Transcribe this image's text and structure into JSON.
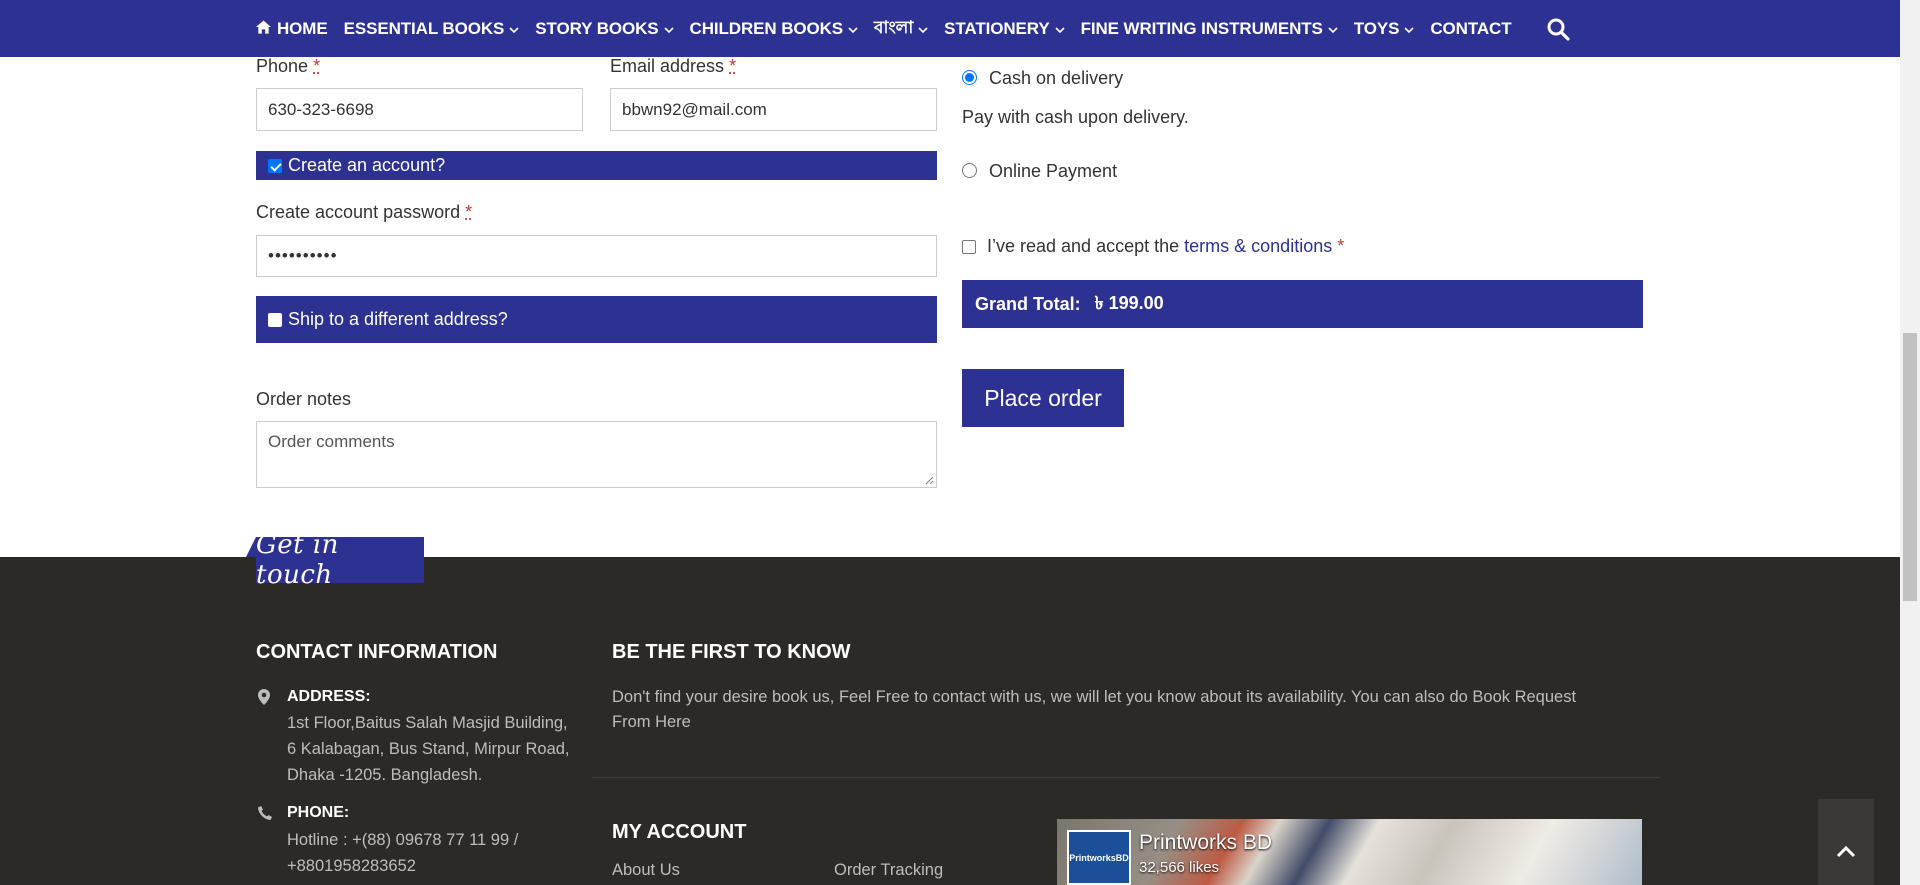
{
  "nav": {
    "items": [
      {
        "label": "HOME",
        "has_home_icon": true,
        "dropdown": false
      },
      {
        "label": "ESSENTIAL BOOKS",
        "dropdown": true
      },
      {
        "label": "STORY BOOKS",
        "dropdown": true
      },
      {
        "label": "CHILDREN BOOKS",
        "dropdown": true
      },
      {
        "label": "বাংলা",
        "dropdown": true
      },
      {
        "label": "STATIONERY",
        "dropdown": true
      },
      {
        "label": "FINE WRITING INSTRUMENTS",
        "dropdown": true
      },
      {
        "label": "TOYS",
        "dropdown": true
      },
      {
        "label": "CONTACT",
        "dropdown": false
      }
    ],
    "search_icon": "search-icon",
    "bg_color": "#2d3192"
  },
  "form": {
    "phone_label": "Phone",
    "phone_value": "630-323-6698",
    "email_label": "Email address",
    "email_value": "bbwn92@mail.com",
    "required_mark": "*",
    "create_account_label": "Create an account?",
    "create_account_checked": true,
    "password_label": "Create account password",
    "password_value": "••••••••••",
    "ship_different_label": "Ship to a different address?",
    "ship_different_checked": false,
    "order_notes_label": "Order notes",
    "order_notes_placeholder": "Order comments"
  },
  "payment": {
    "cod_label": "Cash on delivery",
    "cod_selected": true,
    "cod_description": "Pay with cash upon delivery.",
    "online_label": "Online Payment",
    "online_selected": false,
    "terms_prefix": "I’ve read and accept the",
    "terms_link": "terms & conditions",
    "terms_required": "*",
    "grand_total_label": "Grand Total:",
    "grand_total_value": "৳ 199.00",
    "place_order_label": "Place order"
  },
  "footer": {
    "get_in_touch": "Get in touch",
    "contact_heading": "CONTACT INFORMATION",
    "address_label": "ADDRESS:",
    "address_lines": [
      "1st Floor,Baitus Salah Masjid Building,",
      "6 Kalabagan, Bus Stand, Mirpur Road,",
      "Dhaka -1205. Bangladesh."
    ],
    "phone_label": "PHONE:",
    "phone_lines": [
      "Hotline : +(88) 09678 77 11 99 /",
      "+8801958283652"
    ],
    "first_to_know_heading": "BE THE FIRST TO KNOW",
    "first_to_know_text_1": "Don't find your desire book us, Feel Free to contact with us, we will let you know about its availability. You can also do Book Request",
    "first_to_know_text_2": "From Here",
    "my_account_heading": "MY ACCOUNT",
    "links": [
      "About Us",
      "Order Tracking"
    ],
    "fb_page_name": "Printworks BD",
    "fb_likes": "32,566 likes",
    "fb_logo_text": "PrintworksBD"
  },
  "colors": {
    "brand": "#2d3192",
    "footer_bg": "#2b2a26",
    "required": "#c0392b"
  }
}
